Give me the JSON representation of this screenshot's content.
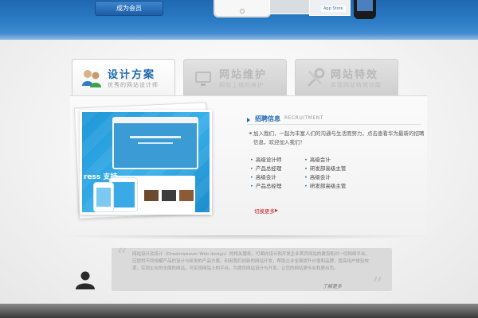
{
  "header": {
    "join_label": "成为会员",
    "device_button": "App Store"
  },
  "tabs": [
    {
      "title": "设计方案",
      "subtitle": "优秀的网站设计师",
      "icon": "people-icon",
      "active": true
    },
    {
      "title": "网站维护",
      "subtitle": "网站上线的维护",
      "icon": "monitor-icon",
      "active": false
    },
    {
      "title": "网站特效",
      "subtitle": "实现网站特效功能",
      "icon": "tools-icon",
      "active": false
    }
  ],
  "showcase": {
    "brand_text": "ress 支持"
  },
  "recruitment": {
    "title": "招聘信息",
    "title_en": "RECRUITMENT",
    "intro": "加入我们，一起为丰富人们的沟通与生活而努力，点击查看华为最新的招聘信息，欢迎加入我们！",
    "jobs": [
      "高级设计师",
      "高级会计",
      "产品总经理",
      "研发部高级主管",
      "高级会计",
      "高级会计",
      "产品总经理",
      "研发部高级主管"
    ],
    "more_label": "切换更多",
    "more_arrow": "▶"
  },
  "testimonial": {
    "text": "网站设计及设计（Dreamweaver Web design）的相关服务，可面向设计和开发企业首页网站的建设和对一切网络平台，应提供不同规模产品的设计与研发的产品方案，利用我们创新的网站开发，帮助企业全面提升价值和品牌，提高用户体验效率，实现企业的全面的网站，可实现网站上的平台。为提供网站设计与开发，让您的网站更专业和更出色。",
    "author": "了解更多",
    "quote_open": "“",
    "quote_close": "”"
  },
  "colors": {
    "banner": "#2c7cc6",
    "accent": "#1e69ae",
    "link": "#c5242b",
    "footer": "#3a3a3a"
  }
}
